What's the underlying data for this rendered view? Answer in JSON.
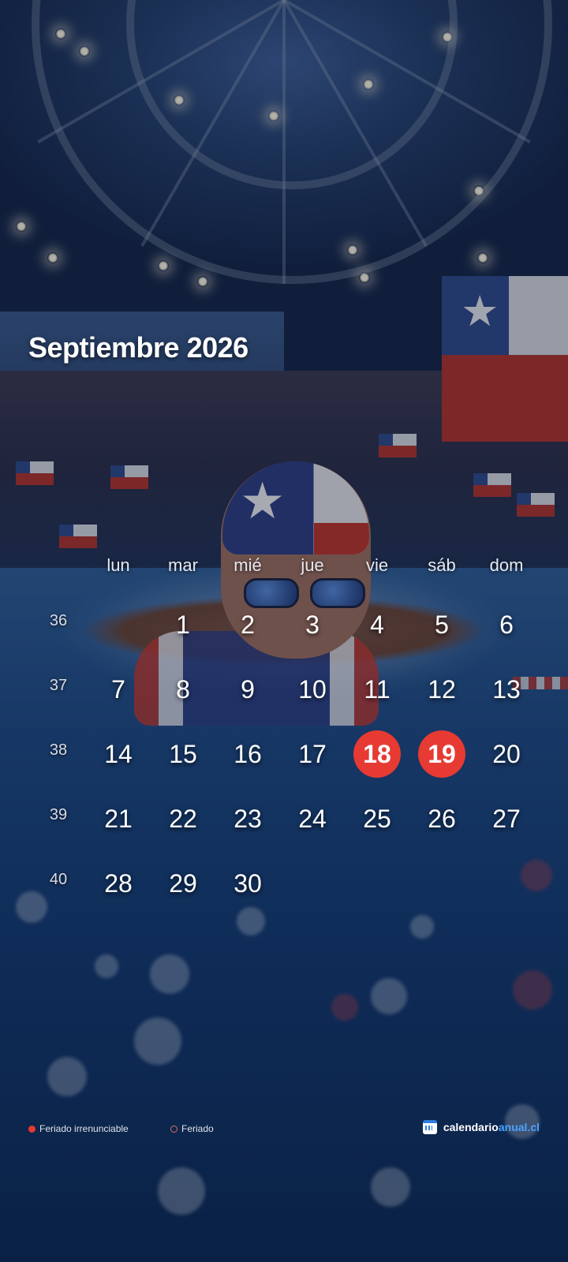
{
  "calendar": {
    "title": "Septiembre 2026",
    "weekdays": [
      "lun",
      "mar",
      "mié",
      "jue",
      "vie",
      "sáb",
      "dom"
    ],
    "weeks": [
      {
        "number": "36",
        "days": [
          "",
          "1",
          "2",
          "3",
          "4",
          "5",
          "6"
        ]
      },
      {
        "number": "37",
        "days": [
          "7",
          "8",
          "9",
          "10",
          "11",
          "12",
          "13"
        ]
      },
      {
        "number": "38",
        "days": [
          "14",
          "15",
          "16",
          "17",
          "18",
          "19",
          "20"
        ]
      },
      {
        "number": "39",
        "days": [
          "21",
          "22",
          "23",
          "24",
          "25",
          "26",
          "27"
        ]
      },
      {
        "number": "40",
        "days": [
          "28",
          "29",
          "30",
          "",
          "",
          "",
          ""
        ]
      }
    ],
    "holidays_irrenunciable": [
      "18",
      "19"
    ]
  },
  "legend": {
    "irrenunciable": "Feriado irrenunciable",
    "feriado": "Feriado"
  },
  "brand": {
    "name_part1": "calendario",
    "name_part2": "anual.cl"
  },
  "colors": {
    "holiday_red": "#e63a33",
    "brand_accent": "#4aa3ff"
  },
  "icons": {
    "brand": "calendar-icon"
  }
}
